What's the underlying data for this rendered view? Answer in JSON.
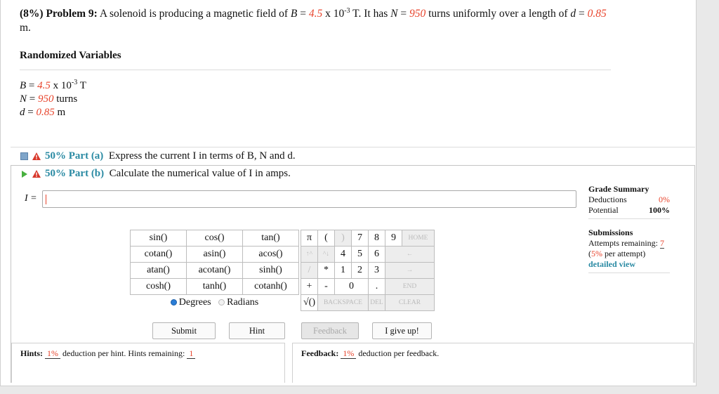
{
  "problem": {
    "percent": "(8%)",
    "label": "Problem 9:",
    "text_a": "A solenoid is producing a magnetic field of",
    "B_sym": "B",
    "B_val": "4.5",
    "B_unit": "x 10",
    "B_exp": "-3",
    "B_tail": "T. It has",
    "N_sym": "N",
    "N_val": "950",
    "text_b": "turns uniformly over a length of",
    "d_sym": "d",
    "d_val": "0.85",
    "d_unit": "m."
  },
  "randomized": {
    "title": "Randomized Variables",
    "B_line": {
      "sym": "B",
      "val": "4.5",
      "mid": "x 10",
      "exp": "-3",
      "unit": "T"
    },
    "N_line": {
      "sym": "N",
      "val": "950",
      "unit": "turns"
    },
    "d_line": {
      "sym": "d",
      "val": "0.85",
      "unit": "m"
    }
  },
  "parts": [
    {
      "pct": "50% Part (a)",
      "text": "Express the current I in terms of B, N and d."
    },
    {
      "pct": "50% Part (b)",
      "text": "Calculate the numerical value of I in amps."
    }
  ],
  "answer": {
    "label": "I =",
    "value": ""
  },
  "grade_summary": {
    "title": "Grade Summary",
    "deductions_label": "Deductions",
    "deductions_value": "0%",
    "potential_label": "Potential",
    "potential_value": "100%",
    "submissions_title": "Submissions",
    "attempts_label": "Attempts remaining:",
    "attempts_value": "7",
    "per_attempt_pct": "5%",
    "per_attempt_text": "per attempt)",
    "detailed_view": "detailed view"
  },
  "calculator": {
    "functions": [
      [
        "sin()",
        "cos()",
        "tan()"
      ],
      [
        "cotan()",
        "asin()",
        "acos()"
      ],
      [
        "atan()",
        "acotan()",
        "sinh()"
      ],
      [
        "cosh()",
        "tanh()",
        "cotanh()"
      ]
    ],
    "degrees": "Degrees",
    "radians": "Radians",
    "pad": {
      "pi": "π",
      "lparen": "(",
      "rparen": ")",
      "d7": "7",
      "d8": "8",
      "d9": "9",
      "home": "HOME",
      "up": "↑^",
      "caret": "^↓",
      "d4": "4",
      "d5": "5",
      "d6": "6",
      "back": "←",
      "div": "/",
      "mul": "*",
      "d1": "1",
      "d2": "2",
      "d3": "3",
      "fwd": "→",
      "plus": "+",
      "minus": "-",
      "d0": "0",
      "dot": ".",
      "end": "END",
      "sqrt": "√()",
      "backspace": "BACKSPACE",
      "del": "DEL",
      "clear": "CLEAR"
    }
  },
  "buttons": {
    "submit": "Submit",
    "hint": "Hint",
    "feedback": "Feedback",
    "give_up": "I give up!"
  },
  "hints": {
    "label": "Hints:",
    "pct": "1%",
    "text": "deduction per hint. Hints remaining:",
    "remaining": "1"
  },
  "feedback": {
    "label": "Feedback:",
    "pct": "1%",
    "text": "deduction per feedback."
  },
  "colors": {
    "accent_red": "#e8442c",
    "teal": "#2a8aa3",
    "radio_blue": "#2a7dd6"
  }
}
